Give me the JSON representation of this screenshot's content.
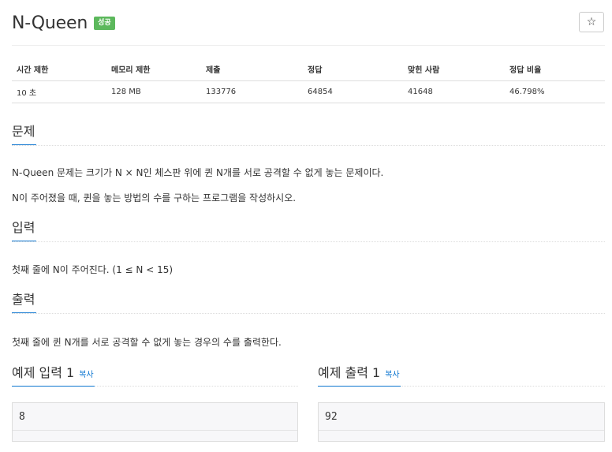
{
  "problem": {
    "title": "N-Queen",
    "badge": "성공",
    "star_icon": "☆"
  },
  "info_table": {
    "headers": [
      "시간 제한",
      "메모리 제한",
      "제출",
      "정답",
      "맞힌 사람",
      "정답 비율"
    ],
    "values": [
      "10 초",
      "128 MB",
      "133776",
      "64854",
      "41648",
      "46.798%"
    ]
  },
  "sections": {
    "problem": {
      "title": "문제",
      "lines": [
        "N-Queen 문제는 크기가 N × N인 체스판 위에 퀸 N개를 서로 공격할 수 없게 놓는 문제이다.",
        "N이 주어졌을 때, 퀸을 놓는 방법의 수를 구하는 프로그램을 작성하시오."
      ]
    },
    "input": {
      "title": "입력",
      "text": "첫째 줄에 N이 주어진다. (1 ≤ N < 15)"
    },
    "output": {
      "title": "출력",
      "text": "첫째 줄에 퀸 N개를 서로 공격할 수 없게 놓는 경우의 수를 출력한다."
    }
  },
  "samples": {
    "input": {
      "title": "예제 입력 1",
      "copy_label": "복사",
      "value": "8"
    },
    "output": {
      "title": "예제 출력 1",
      "copy_label": "복사",
      "value": "92"
    }
  },
  "colors": {
    "badge_green": "#5cb85c",
    "link_blue": "#0e76d0"
  }
}
